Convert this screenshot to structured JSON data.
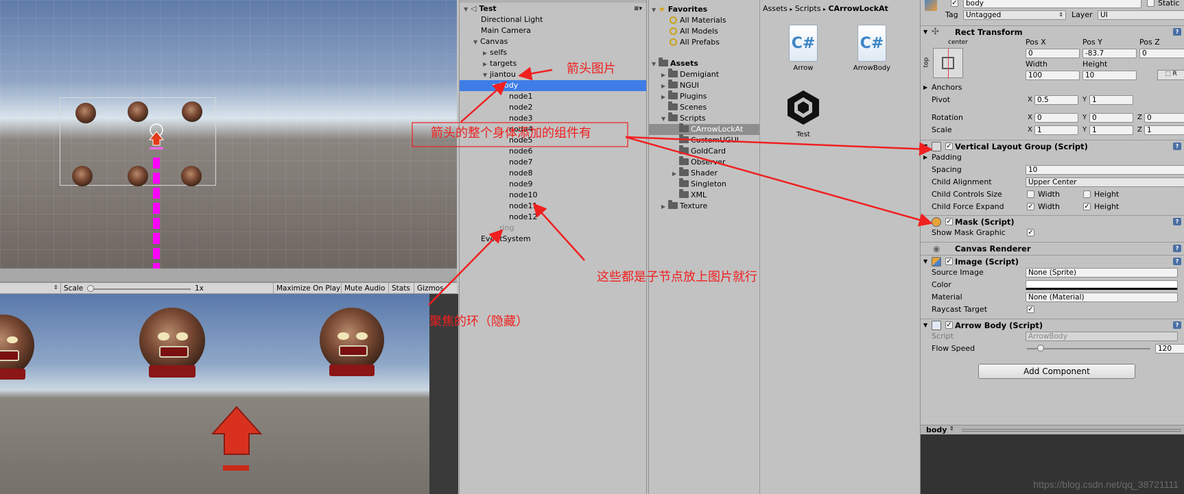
{
  "scene": {
    "scale_label": "Scale",
    "scale_value": "1x",
    "maximize_label": "Maximize On Play",
    "mute_label": "Mute Audio",
    "stats_label": "Stats",
    "gizmos_label": "Gizmos"
  },
  "hierarchy": {
    "root": "Test",
    "items": [
      {
        "label": "Directional Light"
      },
      {
        "label": "Main Camera"
      },
      {
        "label": "Canvas"
      },
      {
        "label": "selfs"
      },
      {
        "label": "targets"
      },
      {
        "label": "jiantou"
      },
      {
        "label": "body"
      },
      {
        "label": "node1"
      },
      {
        "label": "node2"
      },
      {
        "label": "node3"
      },
      {
        "label": "node4"
      },
      {
        "label": "node5"
      },
      {
        "label": "node6"
      },
      {
        "label": "node7"
      },
      {
        "label": "node8"
      },
      {
        "label": "node9"
      },
      {
        "label": "node10"
      },
      {
        "label": "node11"
      },
      {
        "label": "node12"
      },
      {
        "label": "ring"
      },
      {
        "label": "EventSystem"
      }
    ]
  },
  "project": {
    "favorites": "Favorites",
    "fav_items": [
      "All Materials",
      "All Models",
      "All Prefabs"
    ],
    "assets": "Assets",
    "folders": [
      "Demigiant",
      "NGUI",
      "Plugins",
      "Scenes",
      "Scripts",
      "CArrowLockAt",
      "CustomUGUI",
      "GoldCard",
      "Observer",
      "Shader",
      "Singleton",
      "XML",
      "Texture"
    ],
    "breadcrumb": [
      "Assets",
      "Scripts",
      "CArrowLockAt"
    ],
    "grid_items": [
      "Arrow",
      "ArrowBody",
      "Test"
    ]
  },
  "inspector": {
    "name": "body",
    "static_label": "Static",
    "tag_label": "Tag",
    "tag_value": "Untagged",
    "layer_label": "Layer",
    "layer_value": "UI",
    "rect_transform": "Rect Transform",
    "anchor_preset": "center",
    "anchor_side": "top",
    "pos_x_label": "Pos X",
    "pos_y_label": "Pos Y",
    "pos_z_label": "Pos Z",
    "pos_x": "0",
    "pos_y": "-83.7",
    "pos_z": "0",
    "width_label": "Width",
    "height_label": "Height",
    "width": "100",
    "height": "10",
    "anchors": "Anchors",
    "pivot": "Pivot",
    "pivot_x": "0.5",
    "pivot_y": "1",
    "rotation": "Rotation",
    "rot_x": "0",
    "rot_y": "0",
    "rot_z": "0",
    "scale": "Scale",
    "scale_x": "1",
    "scale_y": "1",
    "scale_z": "1",
    "vlg": "Vertical Layout Group (Script)",
    "padding": "Padding",
    "spacing": "Spacing",
    "spacing_value": "10",
    "child_alignment": "Child Alignment",
    "child_alignment_value": "Upper Center",
    "child_controls": "Child Controls Size",
    "child_force": "Child Force Expand",
    "width_opt": "Width",
    "height_opt": "Height",
    "mask": "Mask (Script)",
    "show_mask": "Show Mask Graphic",
    "canvas_renderer": "Canvas Renderer",
    "image": "Image (Script)",
    "source_image": "Source Image",
    "source_image_value": "None (Sprite)",
    "color": "Color",
    "material": "Material",
    "material_value": "None (Material)",
    "raycast": "Raycast Target",
    "arrow_body": "Arrow Body (Script)",
    "script": "Script",
    "script_value": "ArrowBody",
    "flow_speed": "Flow Speed",
    "flow_speed_value": "120",
    "add_component": "Add Component",
    "preview_tab": "body"
  },
  "annotations": {
    "arrow_image": "箭头图片",
    "components": "箭头的整个身体添加的组件有",
    "children": "这些都是子节点放上图片就行",
    "ring": "聚焦的环（隐藏）"
  },
  "watermark": "https://blog.csdn.net/qq_38721111",
  "colors": {
    "selection": "#3e7de7",
    "annotation": "#f02020",
    "dash": "#ff00ff"
  }
}
